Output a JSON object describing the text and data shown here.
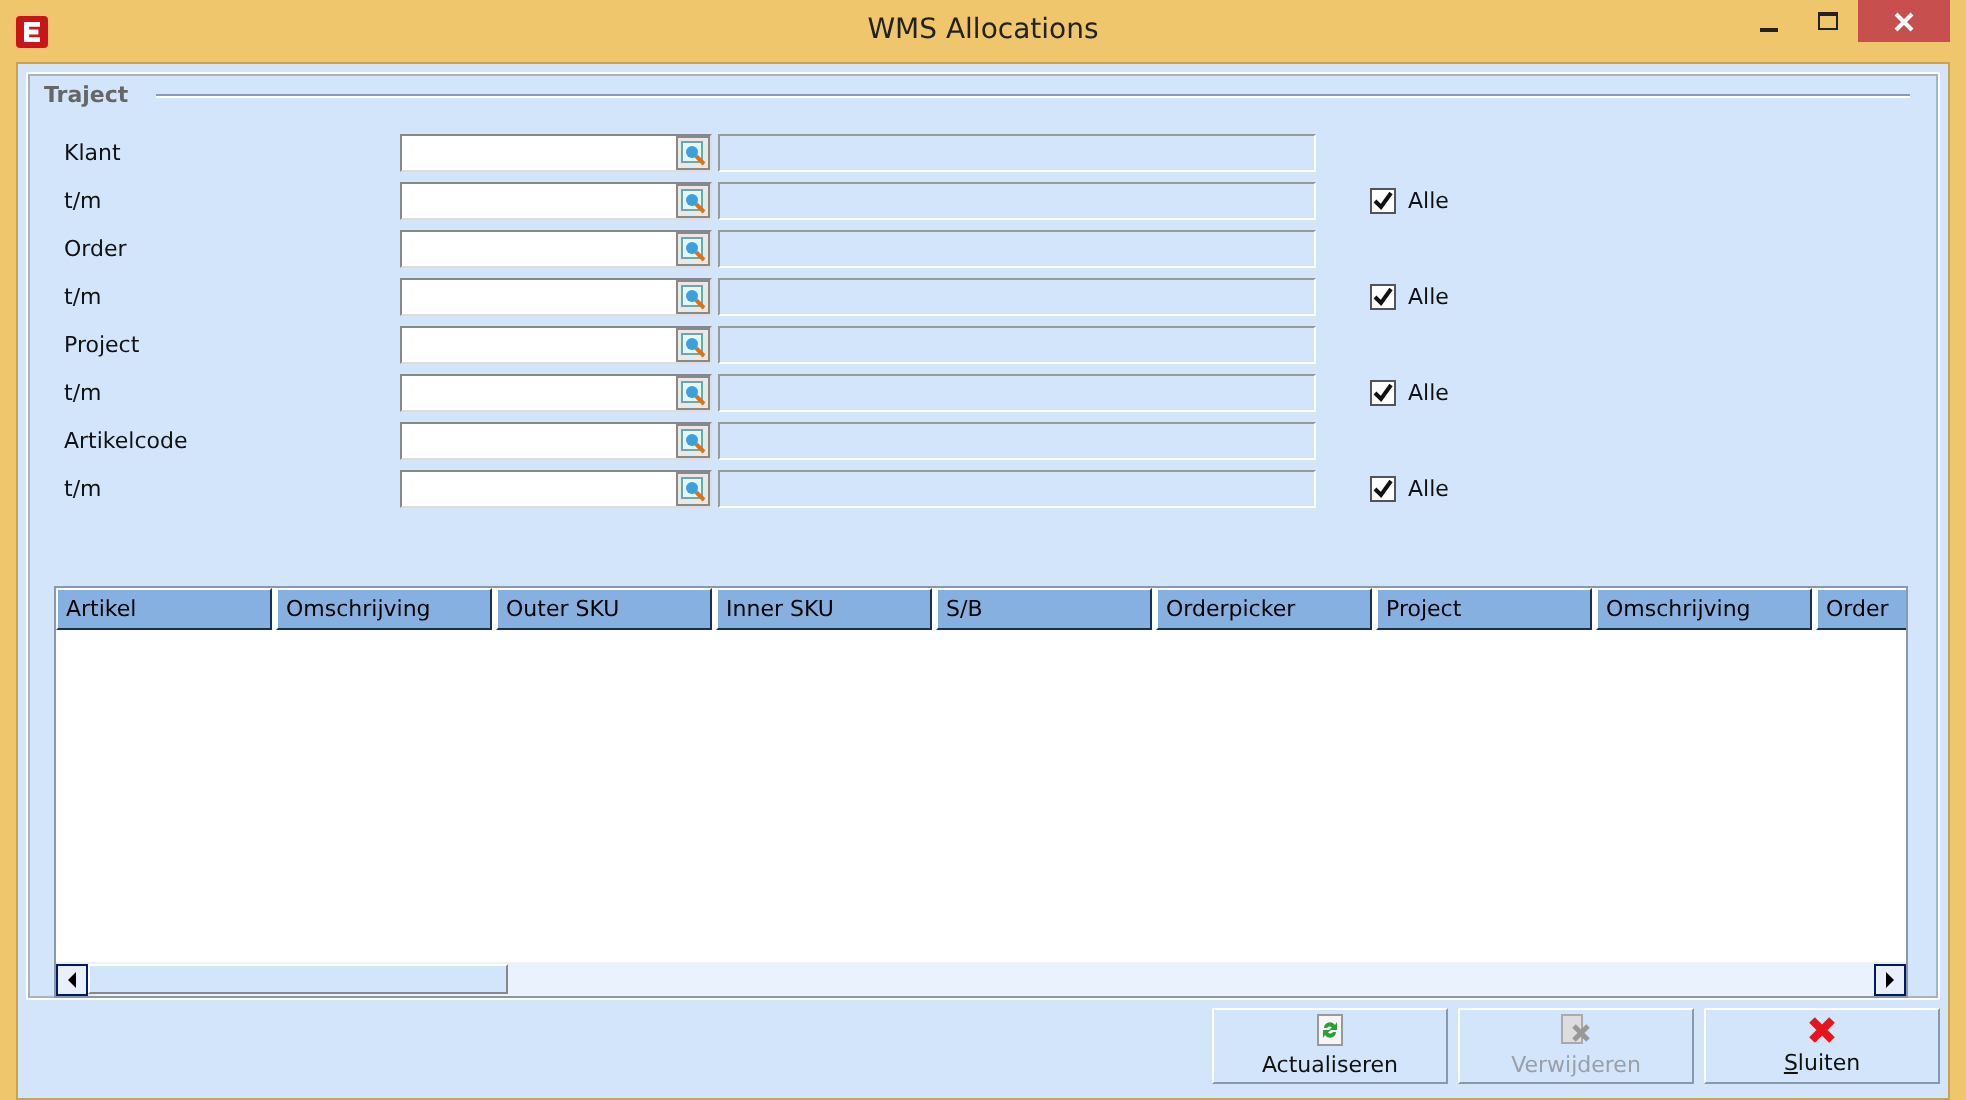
{
  "window": {
    "title": "WMS Allocations"
  },
  "group": {
    "title": "Traject"
  },
  "fields": [
    {
      "label": "Klant"
    },
    {
      "label": "t/m",
      "all": {
        "label": "Alle",
        "checked": true
      }
    },
    {
      "label": "Order"
    },
    {
      "label": "t/m",
      "all": {
        "label": "Alle",
        "checked": true
      }
    },
    {
      "label": "Project"
    },
    {
      "label": "t/m",
      "all": {
        "label": "Alle",
        "checked": true
      }
    },
    {
      "label": "Artikelcode"
    },
    {
      "label": "t/m",
      "all": {
        "label": "Alle",
        "checked": true
      }
    }
  ],
  "table": {
    "columns": [
      "Artikel",
      "Omschrijving",
      "Outer SKU",
      "Inner SKU",
      "S/B",
      "Orderpicker",
      "Project",
      "Omschrijving",
      "Order"
    ]
  },
  "buttons": [
    {
      "label": "Actualiseren",
      "kind": "refresh",
      "disabled": false,
      "underline_first": false
    },
    {
      "label": "Verwijderen",
      "kind": "delete",
      "disabled": true,
      "underline_first": false
    },
    {
      "label": "Sluiten",
      "kind": "close",
      "disabled": false,
      "underline_first": true
    }
  ]
}
